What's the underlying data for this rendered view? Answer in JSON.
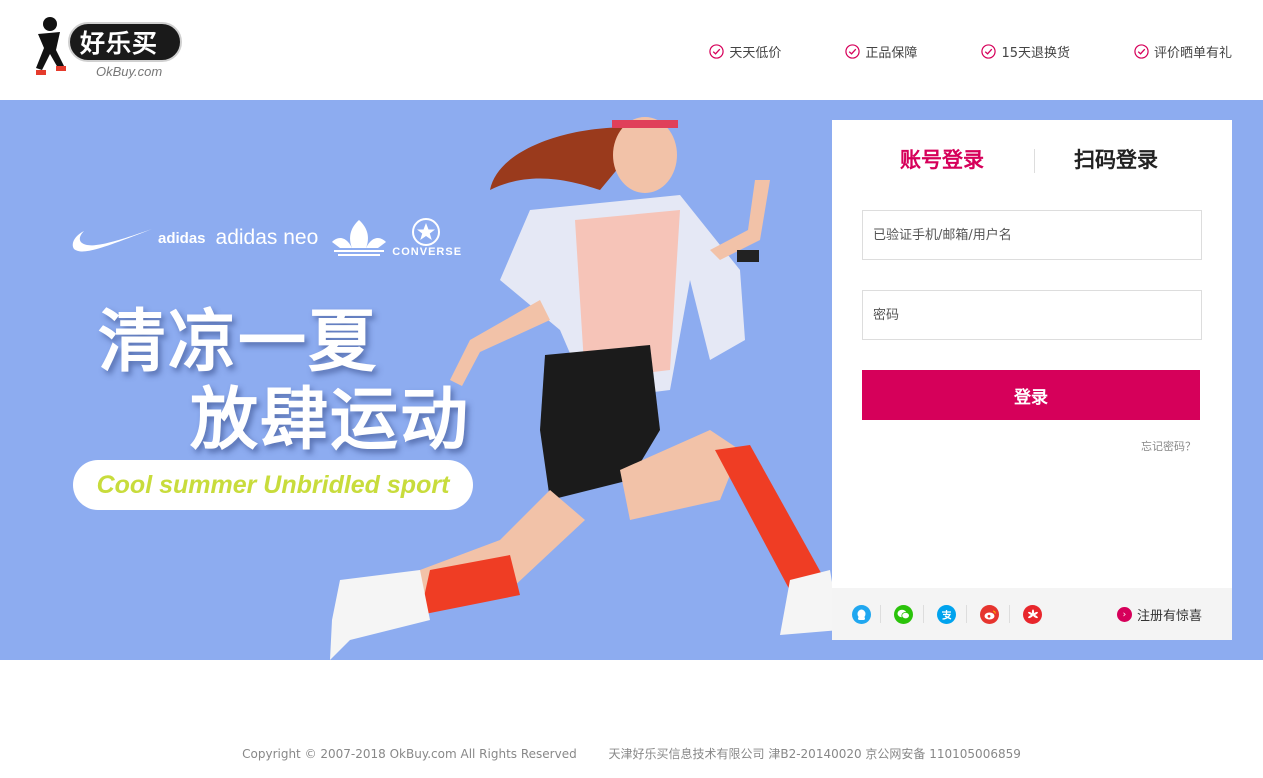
{
  "header": {
    "logo_name": "好乐买",
    "logo_sub": "OkBuy.com",
    "features": [
      "天天低价",
      "正品保障",
      "15天退换货",
      "评价晒单有礼"
    ]
  },
  "banner": {
    "brands": {
      "adidas": "adidas",
      "neo": "adidas neo",
      "converse": "CONVERSE"
    },
    "headline1": "清凉一夏",
    "headline2": "放肆运动",
    "tagline": "Cool summer Unbridled sport"
  },
  "login": {
    "tab_account": "账号登录",
    "tab_qr": "扫码登录",
    "username_placeholder": "已验证手机/邮箱/用户名",
    "password_placeholder": "密码",
    "submit_label": "登录",
    "forgot_label": "忘记密码？",
    "register_label": "注册有惊喜",
    "social_icons": [
      "qq-icon",
      "wechat-icon",
      "alipay-icon",
      "weibo-icon",
      "huawei-icon"
    ]
  },
  "footer": {
    "copyright": "Copyright © 2007-2018 OkBuy.com All Rights Reserved",
    "company": "天津好乐买信息技术有限公司  津B2-20140020  京公网安备 110105006859"
  },
  "colors": {
    "accent": "#d6005a",
    "banner_bg": "#8dacf0",
    "tagline": "#c8dc3c"
  }
}
